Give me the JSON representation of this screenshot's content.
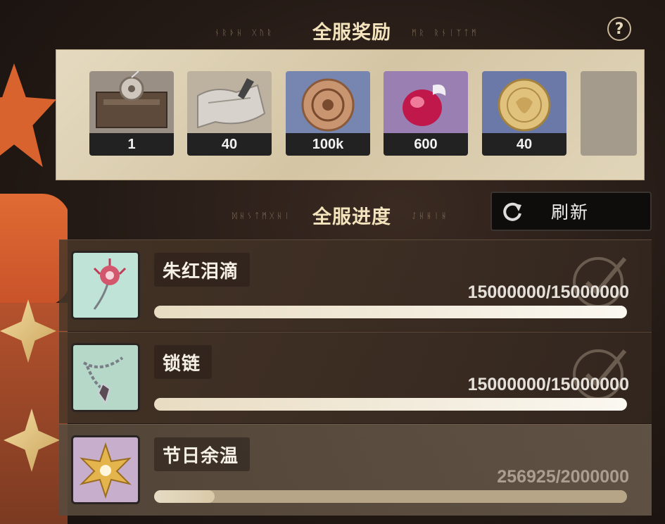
{
  "header": {
    "rewards_title": "全服奖励",
    "progress_title": "全服进度",
    "runes_left_top": "ᚾᚱᚦᚺ ᚷᚢᚱ",
    "runes_right_top": "ᛗᚱ ᚱᚾᛁᛉᛏᛗ",
    "runes_left_mid": "ᛞᚺᛊᛏᛗᚷᚺᛁ",
    "runes_right_mid": "ᛇᚺᚺᛁᚺ",
    "help_label": "?"
  },
  "rewards": [
    {
      "icon": "machine-crate-icon",
      "count": "1"
    },
    {
      "icon": "cloth-scroll-icon",
      "count": "40"
    },
    {
      "icon": "bronze-coin-icon",
      "count": "100k"
    },
    {
      "icon": "red-gem-icon",
      "count": "600"
    },
    {
      "icon": "gold-coin-icon",
      "count": "40"
    }
  ],
  "refresh": {
    "label": "刷新",
    "icon": "refresh-icon"
  },
  "tasks": [
    {
      "name": "朱红泪滴",
      "value": "15000000/15000000",
      "progress": 1.0,
      "status": "complete",
      "icon": "red-flower-icon"
    },
    {
      "name": "锁链",
      "value": "15000000/15000000",
      "progress": 1.0,
      "status": "complete",
      "icon": "chain-pendant-icon"
    },
    {
      "name": "节日余温",
      "value": "256925/2000000",
      "progress": 0.1285,
      "status": "in-progress",
      "icon": "gold-star-icon"
    }
  ],
  "colors": {
    "title": "#f4e4bd",
    "panel": "#e0d4b8",
    "bar_fill": "#f4eee2",
    "accent_orange": "#d9632e"
  }
}
